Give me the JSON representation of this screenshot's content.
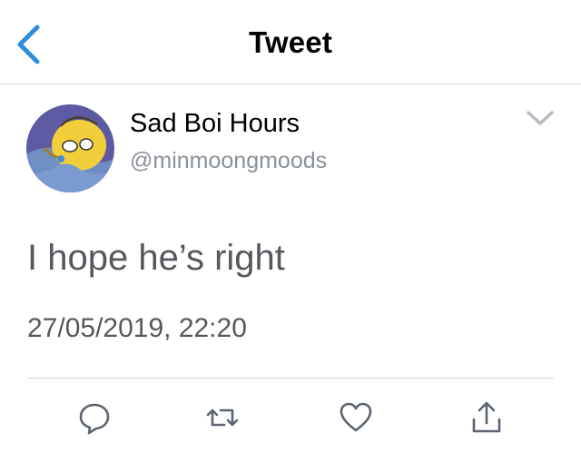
{
  "header": {
    "title": "Tweet",
    "back_icon": "chevron-left-icon"
  },
  "tweet": {
    "author": {
      "display_name": "Sad Boi Hours",
      "handle": "@minmoongmoods"
    },
    "text": "I hope he’s right",
    "timestamp": "27/05/2019, 22:20",
    "menu_icon": "chevron-down-icon"
  },
  "actions": [
    {
      "name": "reply",
      "icon": "reply-icon"
    },
    {
      "name": "retweet",
      "icon": "retweet-icon"
    },
    {
      "name": "like",
      "icon": "heart-icon"
    },
    {
      "name": "share",
      "icon": "share-icon"
    }
  ],
  "colors": {
    "accent": "#2f8ddb",
    "icon_gray": "#5b6470",
    "text_secondary": "#55595e",
    "divider": "#cfd3d8"
  }
}
